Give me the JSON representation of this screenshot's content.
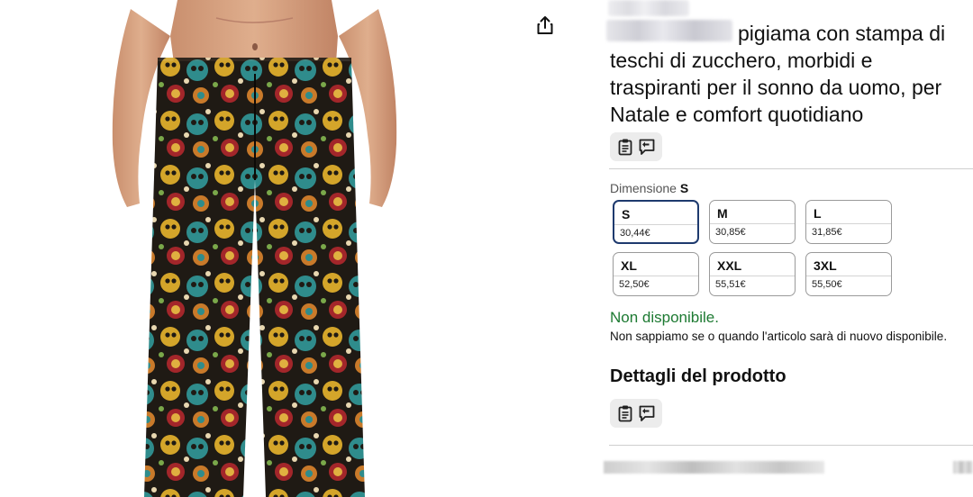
{
  "product": {
    "title": "pigiama con stampa di teschi di zucchero, morbidi e traspiranti per il sonno da uomo, per Natale e comfort quotidiano"
  },
  "dimension": {
    "label": "Dimensione",
    "selected": "S"
  },
  "sizes": [
    {
      "size": "S",
      "price": "30,44€",
      "selected": true
    },
    {
      "size": "M",
      "price": "30,85€",
      "selected": false
    },
    {
      "size": "L",
      "price": "31,85€",
      "selected": false
    },
    {
      "size": "XL",
      "price": "52,50€",
      "selected": false
    },
    {
      "size": "XXL",
      "price": "55,51€",
      "selected": false
    },
    {
      "size": "3XL",
      "price": "55,50€",
      "selected": false
    }
  ],
  "availability": {
    "status": "Non disponibile.",
    "note": "Non sappiamo se o quando l'articolo sarà di nuovo disponibile."
  },
  "details_section": {
    "title": "Dettagli del prodotto"
  },
  "icons": {
    "share": "share-icon",
    "clipboard": "clipboard-icon",
    "feedback": "feedback-icon"
  },
  "colors": {
    "available_status": "#1d7a32",
    "selected_border": "#1e3a6e"
  }
}
